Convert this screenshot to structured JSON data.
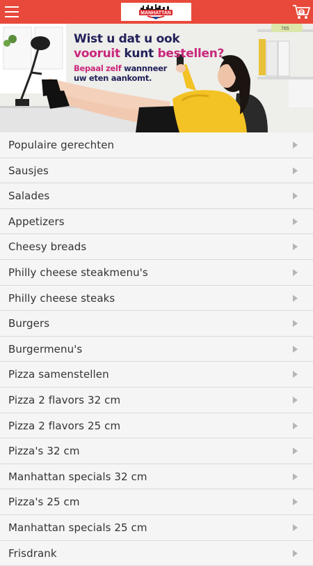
{
  "header": {
    "menu_icon": "hamburger-menu-icon",
    "logo_text": "MANHATTAN",
    "cart_icon": "shopping-cart-icon",
    "cart_count": "0",
    "accent_color": "#e8493a"
  },
  "banner": {
    "line1": "Wist u dat u ook",
    "line2_a": "vooruit",
    "line2_b": "kunt",
    "line2_c": "bestellen?",
    "line3_a": "Bepaal zelf",
    "line3_b": "wannneer",
    "line4": "uw eten aankomt."
  },
  "menu": {
    "items": [
      {
        "label": "Populaire gerechten"
      },
      {
        "label": "Sausjes"
      },
      {
        "label": "Salades"
      },
      {
        "label": "Appetizers"
      },
      {
        "label": "Cheesy breads"
      },
      {
        "label": "Philly cheese steakmenu's"
      },
      {
        "label": "Philly cheese steaks"
      },
      {
        "label": "Burgers"
      },
      {
        "label": "Burgermenu's"
      },
      {
        "label": "Pizza samenstellen"
      },
      {
        "label": "Pizza 2 flavors 32 cm"
      },
      {
        "label": "Pizza 2 flavors 25 cm"
      },
      {
        "label": "Pizza's 32 cm"
      },
      {
        "label": "Manhattan specials 32 cm"
      },
      {
        "label": "Pizza's 25 cm"
      },
      {
        "label": "Manhattan specials 25 cm"
      },
      {
        "label": "Frisdrank"
      }
    ],
    "chevron_icon": "chevron-right-icon"
  }
}
